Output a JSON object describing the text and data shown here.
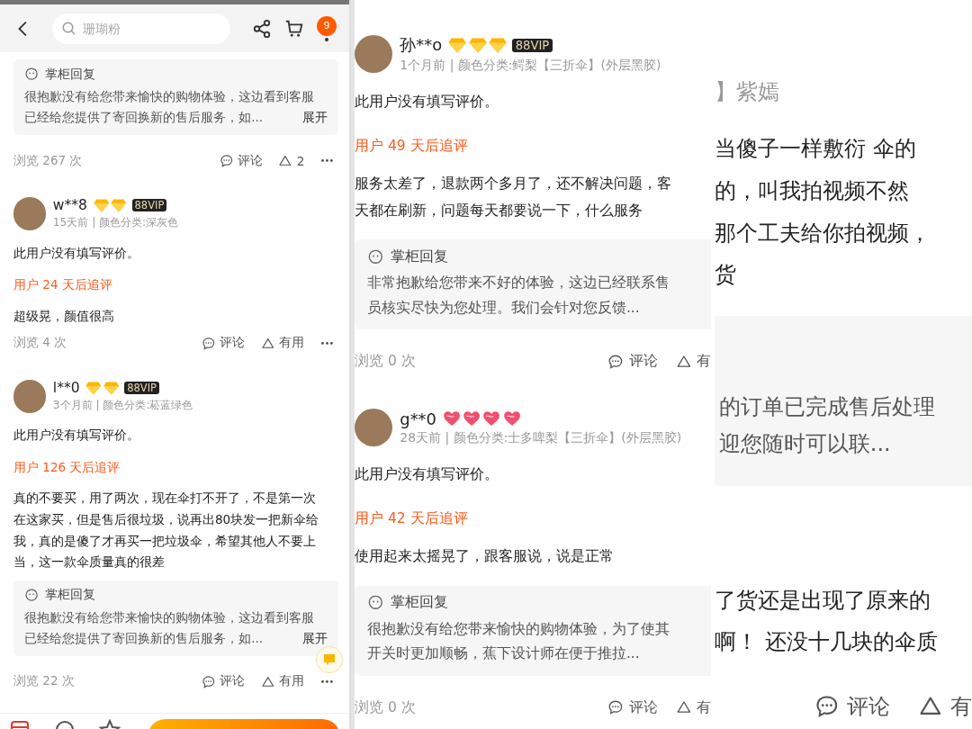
{
  "panels": [
    {
      "kind": "left",
      "header": {
        "search_placeholder": "珊瑚粉",
        "cart_badge": "9"
      },
      "blocks": [
        {
          "kind": "reply",
          "title": "掌柜回复",
          "lines": [
            "很抱歉没有给您带来愉快的购物体验，这边看到客服",
            "已经给您提供了寄回换新的售后服务，如..."
          ],
          "expand": "展开"
        },
        {
          "kind": "footer",
          "views": "浏览 267 次",
          "comment": "评论",
          "useful": "2"
        },
        {
          "kind": "user",
          "name": "w**8",
          "badges": [
            {
              "kind": "diamond"
            },
            {
              "kind": "diamond"
            }
          ],
          "vip": "88VIP",
          "meta": "15天前 | 颜色分类:深灰色"
        },
        {
          "kind": "text",
          "lines": [
            "此用户没有填写评价。"
          ]
        },
        {
          "kind": "followup",
          "text": "用户 24 天后追评"
        },
        {
          "kind": "text",
          "lines": [
            "超级晃，颜值很高"
          ]
        },
        {
          "kind": "footer",
          "views": "浏览 4 次",
          "comment": "评论",
          "useful": "有用"
        },
        {
          "kind": "user",
          "name": "l**0",
          "badges": [
            {
              "kind": "diamond"
            },
            {
              "kind": "diamond"
            }
          ],
          "vip": "88VIP",
          "meta": "3个月前 | 颜色分类:菘蓝绿色"
        },
        {
          "kind": "text",
          "lines": [
            "此用户没有填写评价。"
          ]
        },
        {
          "kind": "followup",
          "text": "用户 126 天后追评"
        },
        {
          "kind": "text",
          "lines": [
            "真的不要买，用了两次，现在伞打不开了，不是第一次",
            "在这家买，但是售后很垃圾，说再出80块发一把新伞给",
            "我，真的是傻了才再买一把垃圾伞，希望其他人不要上",
            "当，这一款伞质量真的很差"
          ]
        },
        {
          "kind": "reply",
          "title": "掌柜回复",
          "lines": [
            "很抱歉没有给您带来愉快的购物体验，这边看到客服",
            "已经给您提供了寄回换新的售后服务，如..."
          ],
          "expand": "展开"
        },
        {
          "kind": "footer",
          "views": "浏览 22 次",
          "comment": "评论",
          "useful": "有用"
        }
      ]
    },
    {
      "kind": "middle",
      "blocks": [
        {
          "kind": "user",
          "name": "孙**o",
          "badges": [
            {
              "kind": "diamond"
            },
            {
              "kind": "diamond"
            },
            {
              "kind": "diamond"
            }
          ],
          "vip": "88VIP",
          "meta": "1个月前 | 颜色分类:鳄梨【三折伞】(外层黑胶)"
        },
        {
          "kind": "text",
          "lines": [
            "此用户没有填写评价。"
          ]
        },
        {
          "kind": "followup",
          "text": "用户 49 天后追评"
        },
        {
          "kind": "text",
          "lines": [
            "服务太差了，退款两个多月了，还不解决问题，客",
            "天都在刷新，问题每天都要说一下，什么服务"
          ]
        },
        {
          "kind": "reply",
          "title": "掌柜回复",
          "lines": [
            "非常抱歉给您带来不好的体验，这边已经联系售",
            "员核实尽快为您处理。我们会针对您反馈..."
          ]
        },
        {
          "kind": "footer",
          "views": "浏览 0 次",
          "comment": "评论",
          "useful": "有"
        },
        {
          "kind": "user",
          "name": "g**0",
          "badges": [
            {
              "kind": "heart"
            },
            {
              "kind": "heart"
            },
            {
              "kind": "heart"
            },
            {
              "kind": "heart"
            }
          ],
          "meta": "28天前 | 颜色分类:士多啤梨【三折伞】(外层黑胶)"
        },
        {
          "kind": "text",
          "lines": [
            "此用户没有填写评价。"
          ]
        },
        {
          "kind": "followup",
          "text": "用户 42 天后追评"
        },
        {
          "kind": "text",
          "lines": [
            "使用起来太摇晃了，跟客服说，说是正常"
          ]
        },
        {
          "kind": "reply",
          "title": "掌柜回复",
          "lines": [
            "很抱歉没有给您带来愉快的购物体验，为了使其",
            "开关时更加顺畅，蕉下设计师在便于推拉..."
          ]
        },
        {
          "kind": "footer",
          "views": "浏览 0 次",
          "comment": "评论",
          "useful": "有"
        }
      ]
    },
    {
      "kind": "right",
      "blocks": [
        {
          "kind": "meta",
          "text": "】紫嫣"
        },
        {
          "kind": "text",
          "lines": [
            "当傻子一样敷衍 伞的",
            "的，叫我拍视频不然",
            "那个工夫给你拍视频，",
            "货"
          ]
        },
        {
          "kind": "reply",
          "lines": [
            "的订单已完成售后处理",
            "迎您随时可以联..."
          ]
        },
        {
          "kind": "text",
          "lines": [
            "了货还是出现了原来的",
            "啊！ 还没十几块的伞质"
          ]
        },
        {
          "kind": "footer",
          "comment": "评论",
          "useful": "有"
        }
      ]
    }
  ]
}
